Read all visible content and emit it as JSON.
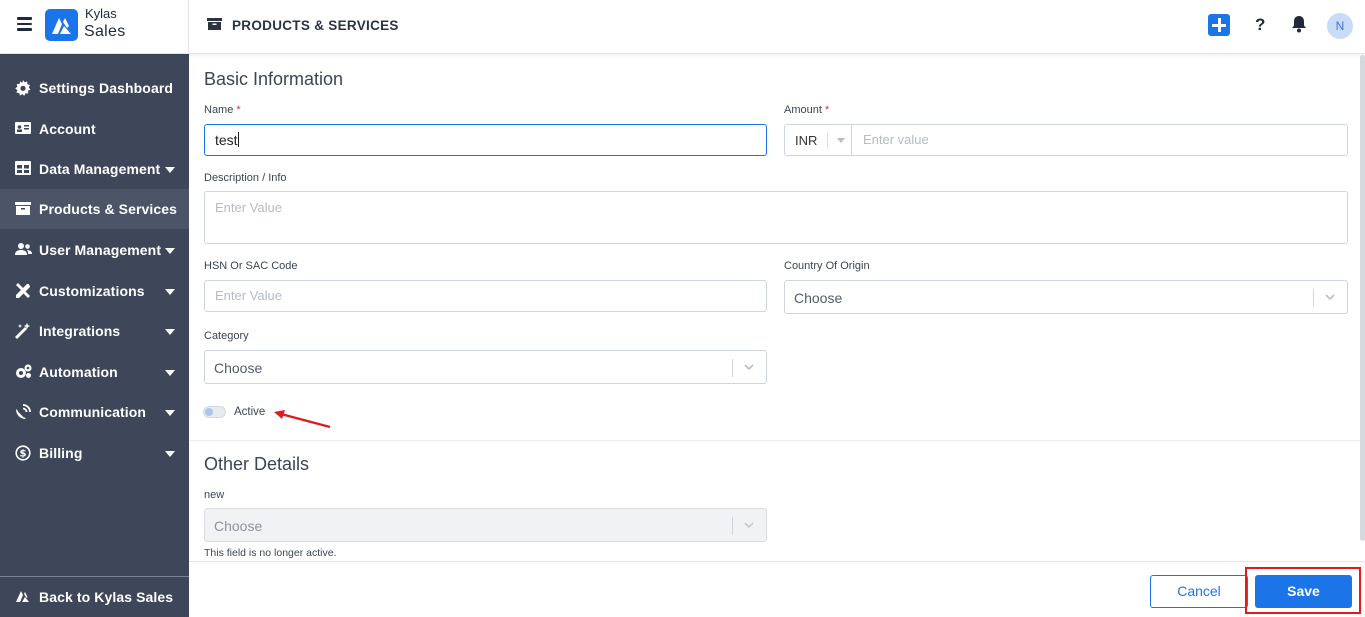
{
  "app": {
    "brand_top": "Kylas",
    "brand_bottom": "Sales",
    "page_title": "PRODUCTS & SERVICES",
    "help_label": "?",
    "avatar_initial": "N"
  },
  "sidebar": {
    "items": [
      {
        "label": "Settings Dashboard",
        "icon": "gear-icon",
        "has_caret": false
      },
      {
        "label": "Account",
        "icon": "id-card-icon",
        "has_caret": false
      },
      {
        "label": "Data Management",
        "icon": "table-icon",
        "has_caret": true
      },
      {
        "label": "Products & Services",
        "icon": "box-icon",
        "has_caret": false,
        "active": true
      },
      {
        "label": "User Management",
        "icon": "users-icon",
        "has_caret": true
      },
      {
        "label": "Customizations",
        "icon": "tools-icon",
        "has_caret": true
      },
      {
        "label": "Integrations",
        "icon": "magic-wand-icon",
        "has_caret": true
      },
      {
        "label": "Automation",
        "icon": "cogs-icon",
        "has_caret": true
      },
      {
        "label": "Communication",
        "icon": "satellite-dish-icon",
        "has_caret": true
      },
      {
        "label": "Billing",
        "icon": "dollar-circle-icon",
        "has_caret": true
      }
    ],
    "back_label": "Back to Kylas Sales"
  },
  "form": {
    "basic_title": "Basic Information",
    "name_label": "Name",
    "name_value": "test",
    "amount_label": "Amount",
    "currency": "INR",
    "amount_placeholder": "Enter value",
    "description_label": "Description / Info",
    "description_placeholder": "Enter Value",
    "hsn_label": "HSN Or SAC Code",
    "hsn_placeholder": "Enter Value",
    "country_label": "Country Of Origin",
    "country_value": "Choose",
    "category_label": "Category",
    "category_value": "Choose",
    "active_label": "Active",
    "active_on": false,
    "required_mark": "*",
    "other_title": "Other Details",
    "new_label": "new",
    "new_value": "Choose",
    "new_helper": "This field is no longer active."
  },
  "footer": {
    "cancel_label": "Cancel",
    "save_label": "Save"
  },
  "colors": {
    "sidebar_bg": "#3e4759",
    "accent": "#1c75e8",
    "highlight": "#e01b1b"
  }
}
